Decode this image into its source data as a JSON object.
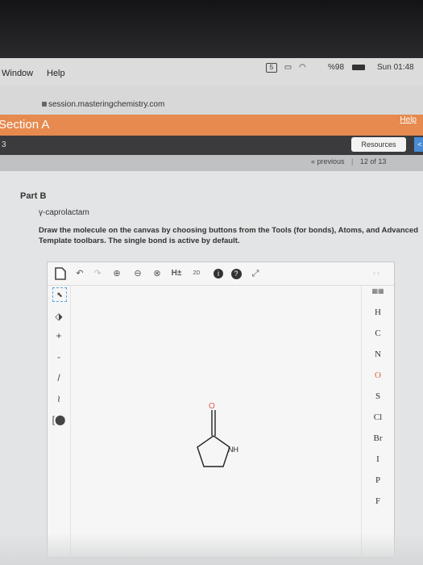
{
  "menubar": {
    "items": [
      "Window",
      "Help"
    ],
    "battery": "%98",
    "clock": "Sun 01:48"
  },
  "browser": {
    "url": "session.masteringchemistry.com"
  },
  "header": {
    "section": "Section A",
    "help": "Help",
    "number": "3",
    "resources": "Resources",
    "previous": "« previous",
    "separator": "|",
    "position": "12 of 13"
  },
  "question": {
    "part": "Part B",
    "molecule": "γ-caprolactam",
    "instructions": "Draw the molecule on the canvas by choosing buttons from the Tools (for bonds), Atoms, and Advanced Template toolbars. The single bond is active by default."
  },
  "toolbar": {
    "h_label": "H±",
    "two_d": "2D"
  },
  "canvas": {
    "o_label": "O",
    "nh_label": "NH"
  },
  "atoms": [
    "H",
    "C",
    "N",
    "O",
    "S",
    "Cl",
    "Br",
    "I",
    "P",
    "F"
  ],
  "colors": {
    "orange": "#e68a4f",
    "oxygen": "#e05c44"
  }
}
